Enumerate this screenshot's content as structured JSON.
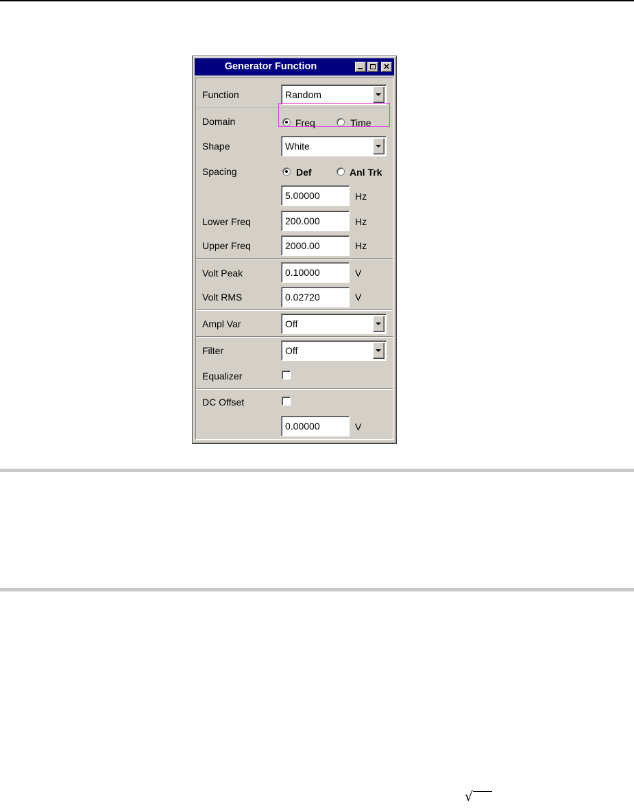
{
  "window": {
    "title": "Generator Function",
    "controls": [
      "minimize",
      "maximize",
      "close"
    ]
  },
  "function": {
    "label": "Function",
    "value": "Random"
  },
  "domain": {
    "label": "Domain",
    "options": [
      {
        "label": "Freq",
        "selected": true
      },
      {
        "label": "Time",
        "selected": false
      }
    ],
    "highlight_color": "#e040e0"
  },
  "shape": {
    "label": "Shape",
    "value": "White"
  },
  "spacing": {
    "label": "Spacing",
    "options": [
      {
        "label": "Def",
        "selected": true
      },
      {
        "label": "Anl Trk",
        "selected": false
      }
    ],
    "value": "5.00000",
    "unit": "Hz"
  },
  "lower_freq": {
    "label": "Lower Freq",
    "value": "200.000",
    "unit": "Hz"
  },
  "upper_freq": {
    "label": "Upper Freq",
    "value": "2000.00",
    "unit": "Hz"
  },
  "volt_peak": {
    "label": "Volt Peak",
    "value": "0.10000",
    "unit": "V"
  },
  "volt_rms": {
    "label": "Volt RMS",
    "value": "0.02720",
    "unit": "V"
  },
  "ampl_var": {
    "label": "Ampl Var",
    "value": "Off"
  },
  "filter": {
    "label": "Filter",
    "value": "Off"
  },
  "equalizer": {
    "label": "Equalizer",
    "checked": false
  },
  "dc_offset": {
    "label": "DC Offset",
    "checked": false,
    "value": "0.00000",
    "unit": "V"
  },
  "page": {
    "title_color": "#000080",
    "panel_color": "#d4d0c8",
    "sqrt_symbol": "√"
  }
}
